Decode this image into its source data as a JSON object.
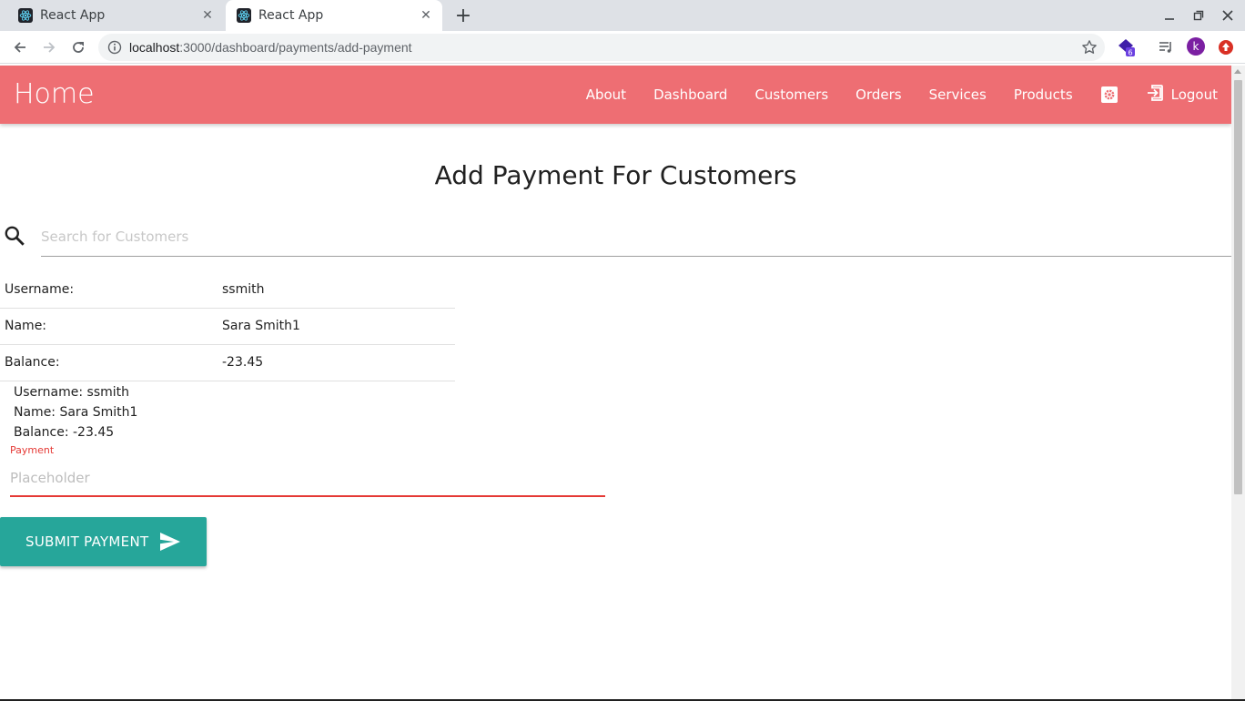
{
  "browser": {
    "tabs": [
      {
        "title": "React App",
        "active": false
      },
      {
        "title": "React App",
        "active": true
      }
    ],
    "url_host": "localhost",
    "url_path": ":3000/dashboard/payments/add-payment",
    "extension_badge": "6",
    "profile_initial": "k"
  },
  "navbar": {
    "brand": "Home",
    "links": [
      "About",
      "Dashboard",
      "Customers",
      "Orders",
      "Services",
      "Products"
    ],
    "logout": "Logout",
    "color": "#ee6e73"
  },
  "page": {
    "title": "Add Payment For Customers",
    "search_placeholder": "Search for Customers"
  },
  "customer_table": [
    {
      "label": "Username:",
      "value": "ssmith"
    },
    {
      "label": "Name:",
      "value": "Sara Smith1"
    },
    {
      "label": "Balance:",
      "value": "-23.45"
    }
  ],
  "summary": {
    "username": "Username: ssmith",
    "name": "Name: Sara Smith1",
    "balance": "Balance: -23.45"
  },
  "payment_field": {
    "label": "Payment",
    "placeholder": "Placeholder",
    "accent": "#e53935"
  },
  "submit_button": {
    "label": "SUBMIT PAYMENT",
    "color": "#26a69a"
  }
}
